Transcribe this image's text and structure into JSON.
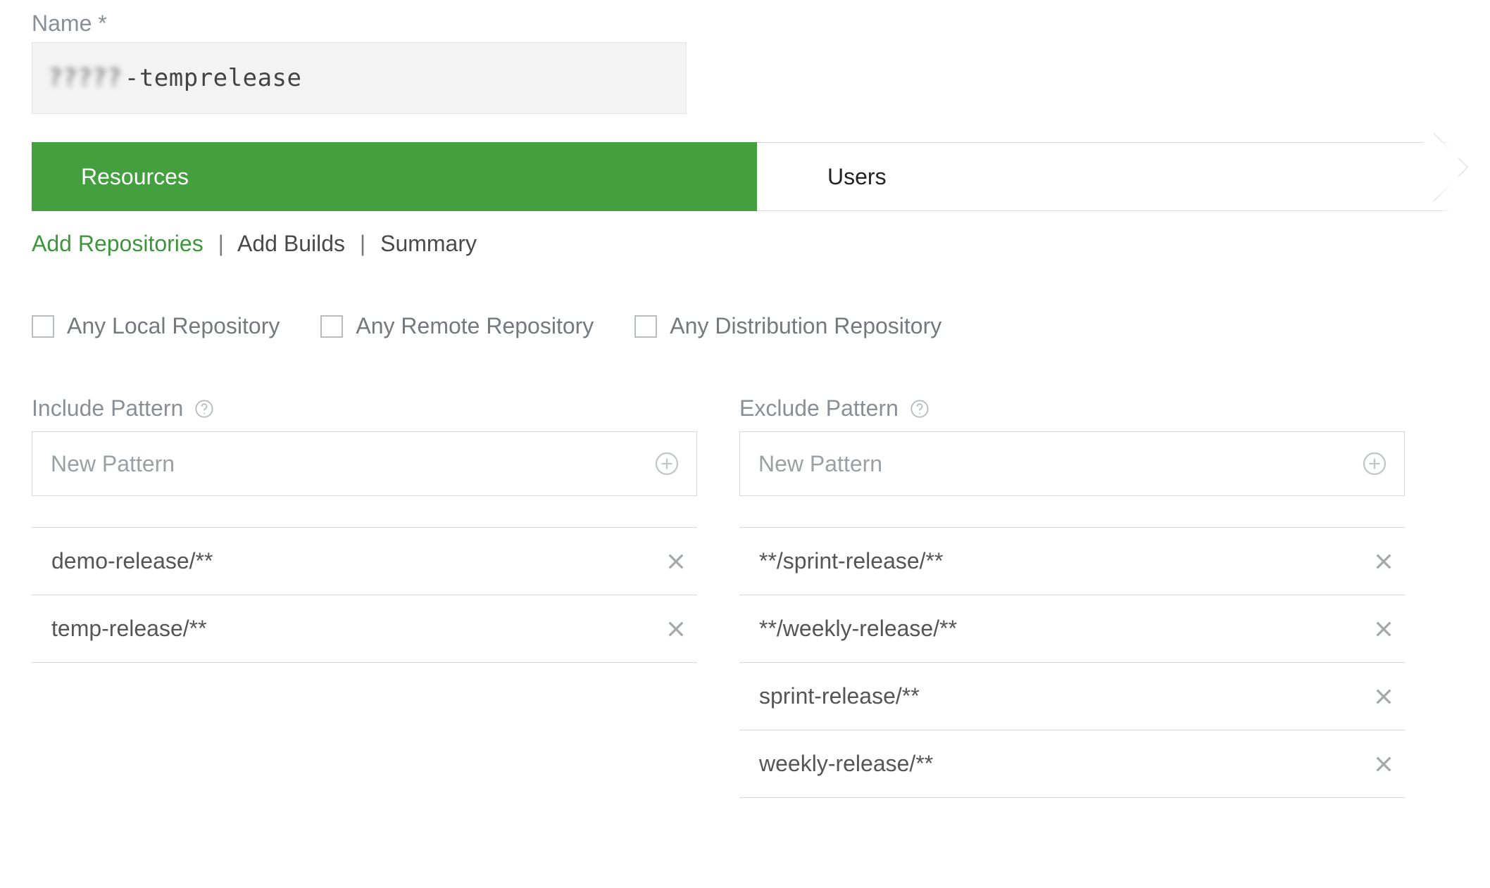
{
  "name_field": {
    "label": "Name *",
    "value_hidden_prefix": "?????",
    "value_suffix": "-temprelease"
  },
  "wizard": {
    "tabs": [
      {
        "label": "Resources",
        "active": true
      },
      {
        "label": "Users",
        "active": false
      }
    ]
  },
  "subnav": {
    "items": [
      {
        "label": "Add Repositories",
        "active": true
      },
      {
        "label": "Add Builds",
        "active": false
      },
      {
        "label": "Summary",
        "active": false
      }
    ],
    "sep": "|"
  },
  "repo_checkboxes": [
    {
      "label": "Any Local Repository",
      "checked": false
    },
    {
      "label": "Any Remote Repository",
      "checked": false
    },
    {
      "label": "Any Distribution Repository",
      "checked": false
    }
  ],
  "include": {
    "heading": "Include Pattern",
    "placeholder": "New Pattern",
    "items": [
      "demo-release/**",
      "temp-release/**"
    ]
  },
  "exclude": {
    "heading": "Exclude Pattern",
    "placeholder": "New Pattern",
    "items": [
      "**/sprint-release/**",
      "**/weekly-release/**",
      "sprint-release/**",
      "weekly-release/**"
    ]
  }
}
